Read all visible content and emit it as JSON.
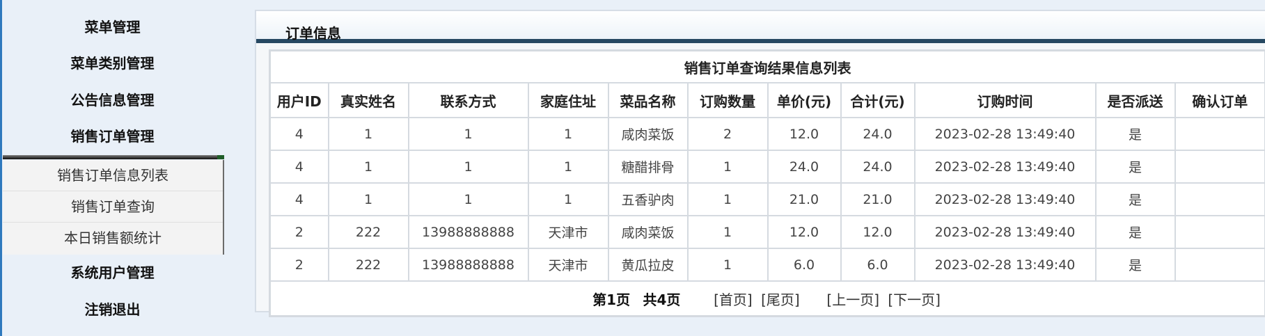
{
  "sidebar": {
    "items": [
      {
        "label": "菜单管理"
      },
      {
        "label": "菜单类别管理"
      },
      {
        "label": "公告信息管理"
      },
      {
        "label": "销售订单管理"
      },
      {
        "label": "系统用户管理"
      },
      {
        "label": "注销退出"
      }
    ],
    "submenu": [
      {
        "label": "销售订单信息列表"
      },
      {
        "label": "销售订单查询"
      },
      {
        "label": "本日销售额统计"
      }
    ]
  },
  "panel": {
    "title": "订单信息"
  },
  "table": {
    "caption": "销售订单查询结果信息列表",
    "headers": [
      "用户ID",
      "真实姓名",
      "联系方式",
      "家庭住址",
      "菜品名称",
      "订购数量",
      "单价(元)",
      "合计(元)",
      "订购时间",
      "是否派送",
      "确认订单"
    ],
    "rows": [
      [
        "4",
        "1",
        "1",
        "1",
        "咸肉菜饭",
        "2",
        "12.0",
        "24.0",
        "2023-02-28 13:49:40",
        "是",
        ""
      ],
      [
        "4",
        "1",
        "1",
        "1",
        "糖醋排骨",
        "1",
        "24.0",
        "24.0",
        "2023-02-28 13:49:40",
        "是",
        ""
      ],
      [
        "4",
        "1",
        "1",
        "1",
        "五香驴肉",
        "1",
        "21.0",
        "21.0",
        "2023-02-28 13:49:40",
        "是",
        ""
      ],
      [
        "2",
        "222",
        "13988888888",
        "天津市",
        "咸肉菜饭",
        "1",
        "12.0",
        "12.0",
        "2023-02-28 13:49:40",
        "是",
        ""
      ],
      [
        "2",
        "222",
        "13988888888",
        "天津市",
        "黄瓜拉皮",
        "1",
        "6.0",
        "6.0",
        "2023-02-28 13:49:40",
        "是",
        ""
      ]
    ]
  },
  "pager": {
    "current_page": "第1页",
    "total_pages": "共4页",
    "first": "[首页]",
    "last": "[尾页]",
    "prev": "[上一页]",
    "next": "[下一页]"
  }
}
